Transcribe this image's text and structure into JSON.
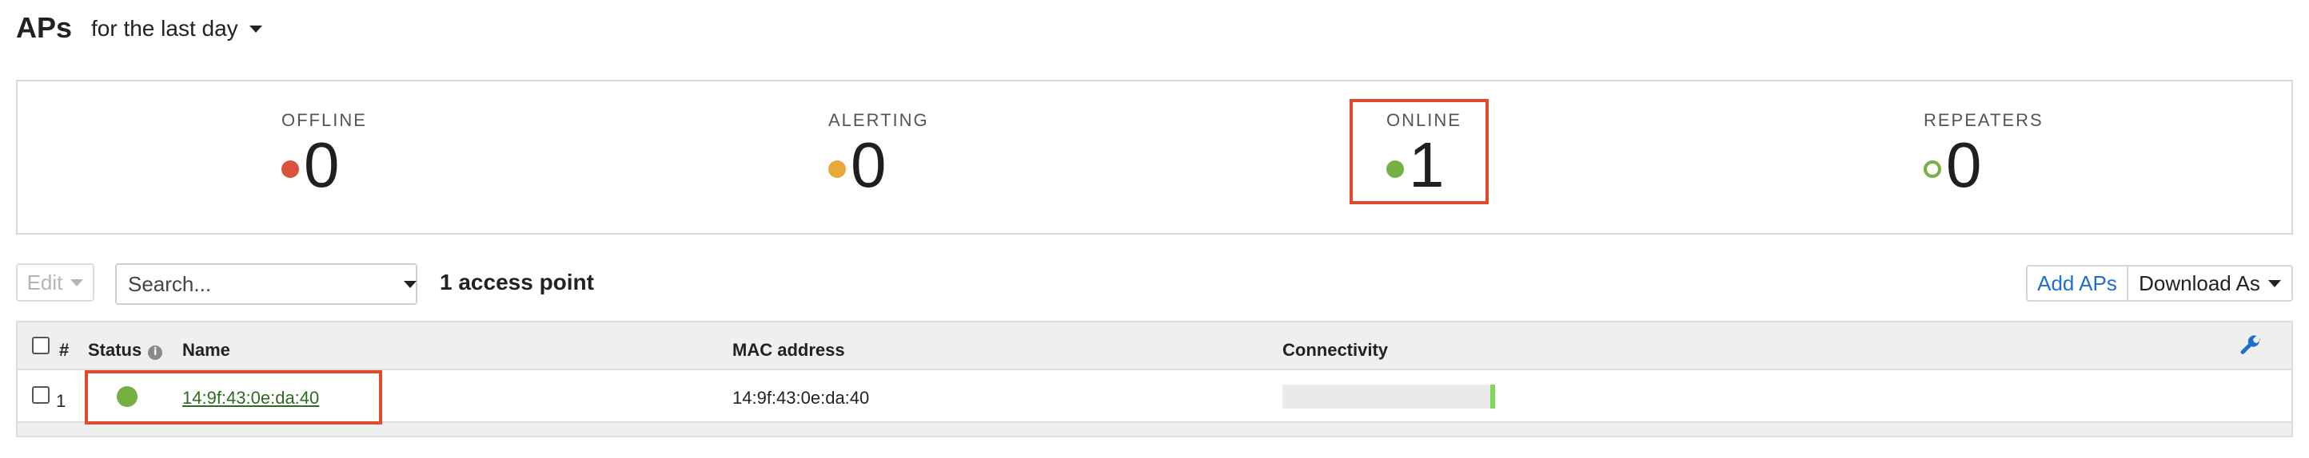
{
  "header": {
    "title": "APs",
    "time_range": "for the last day"
  },
  "summary": {
    "offline": {
      "label": "OFFLINE",
      "value": "0",
      "color": "#d9533b"
    },
    "alerting": {
      "label": "ALERTING",
      "value": "0",
      "color": "#e8a93a"
    },
    "online": {
      "label": "ONLINE",
      "value": "1",
      "color": "#76b043"
    },
    "repeaters": {
      "label": "REPEATERS",
      "value": "0",
      "color": "#76b043"
    }
  },
  "toolbar": {
    "edit_label": "Edit",
    "search_placeholder": "Search...",
    "count_text": "1 access point",
    "add_aps_label": "Add APs",
    "download_label": "Download As"
  },
  "table": {
    "columns": {
      "number": "#",
      "status": "Status",
      "name": "Name",
      "mac": "MAC address",
      "connectivity": "Connectivity"
    },
    "rows": [
      {
        "number": "1",
        "status": "online",
        "name": "14:9f:43:0e:da:40",
        "mac": "14:9f:43:0e:da:40",
        "connectivity": 0.02
      }
    ]
  },
  "icons": {
    "settings": "wrench-icon",
    "status_info": "info-icon"
  },
  "colors": {
    "highlight": "#e04b2e",
    "link": "#1f6fd1",
    "status_online": "#76b043"
  }
}
